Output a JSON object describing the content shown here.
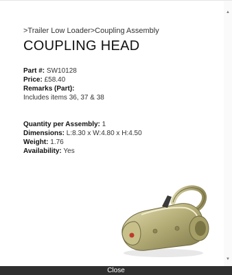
{
  "breadcrumb": ">Trailer Low Loader>Coupling Assembly",
  "title": "COUPLING HEAD",
  "part": {
    "label": "Part #:",
    "value": "SW10128"
  },
  "price": {
    "label": "Price:",
    "value": "£58.40"
  },
  "remarks": {
    "label": "Remarks (Part):",
    "value": "Includes items 36, 37 & 38"
  },
  "quantity": {
    "label": "Quantity per Assembly:",
    "value": "1"
  },
  "dimensions": {
    "label": "Dimensions:",
    "value": "L:8.30 x W:4.80 x H:4.50"
  },
  "weight": {
    "label": "Weight:",
    "value": "1.76"
  },
  "availability": {
    "label": "Availability:",
    "value": "Yes"
  },
  "close_label": "Close",
  "colors": {
    "close_bar": "#2f2f2f",
    "metal": "#b9b27a"
  }
}
